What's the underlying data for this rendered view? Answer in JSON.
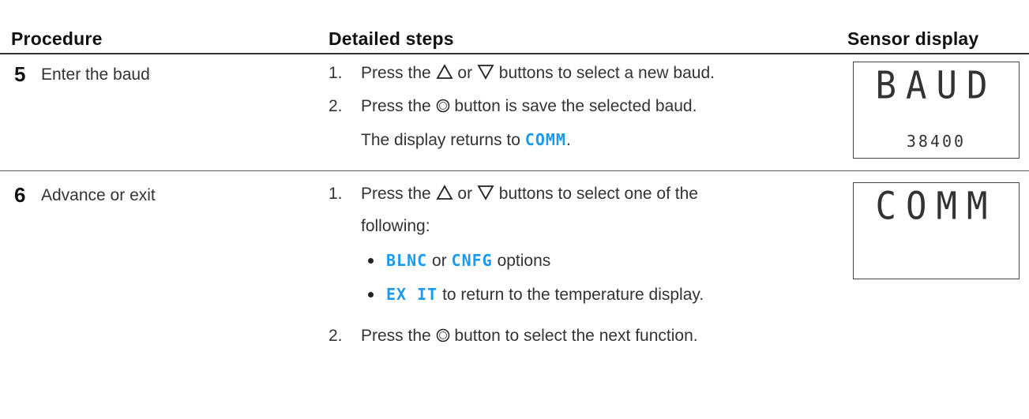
{
  "table": {
    "headers": {
      "procedure": "Procedure",
      "detailed_steps": "Detailed steps",
      "sensor_display": "Sensor display"
    },
    "rows": [
      {
        "number": "5",
        "procedure": "Enter the baud",
        "step1_num": "1.",
        "step1_a": "Press the",
        "step1_or": "or",
        "step1_b": "buttons to select a new baud.",
        "step2_num": "2.",
        "step2_a": "Press the",
        "step2_b": "button is save the selected baud.",
        "note_a": "The display returns to",
        "note_code": "COMM",
        "note_b": ".",
        "display_big": "BAUD",
        "display_small": "38400"
      },
      {
        "number": "6",
        "procedure": "Advance or exit",
        "step1_num": "1.",
        "step1_a": "Press the",
        "step1_or": "or",
        "step1_b": "buttons to select one of the",
        "step1_c": "following:",
        "bullet1_code1": "BLNC",
        "bullet1_or": "or",
        "bullet1_code2": "CNFG",
        "bullet1_text": "options",
        "bullet2_code": "EX IT",
        "bullet2_text": "to return to the temperature display.",
        "step2_num": "2.",
        "step2_a": "Press the",
        "step2_b": "button to select the next function.",
        "display_big": "COMM",
        "display_small": ""
      }
    ]
  },
  "icons": {
    "up": "up-triangle-icon",
    "down": "down-triangle-icon",
    "set": "set-point-button-icon"
  },
  "colors": {
    "segment_code": "#1a9bf0",
    "header_rule": "#333333"
  }
}
